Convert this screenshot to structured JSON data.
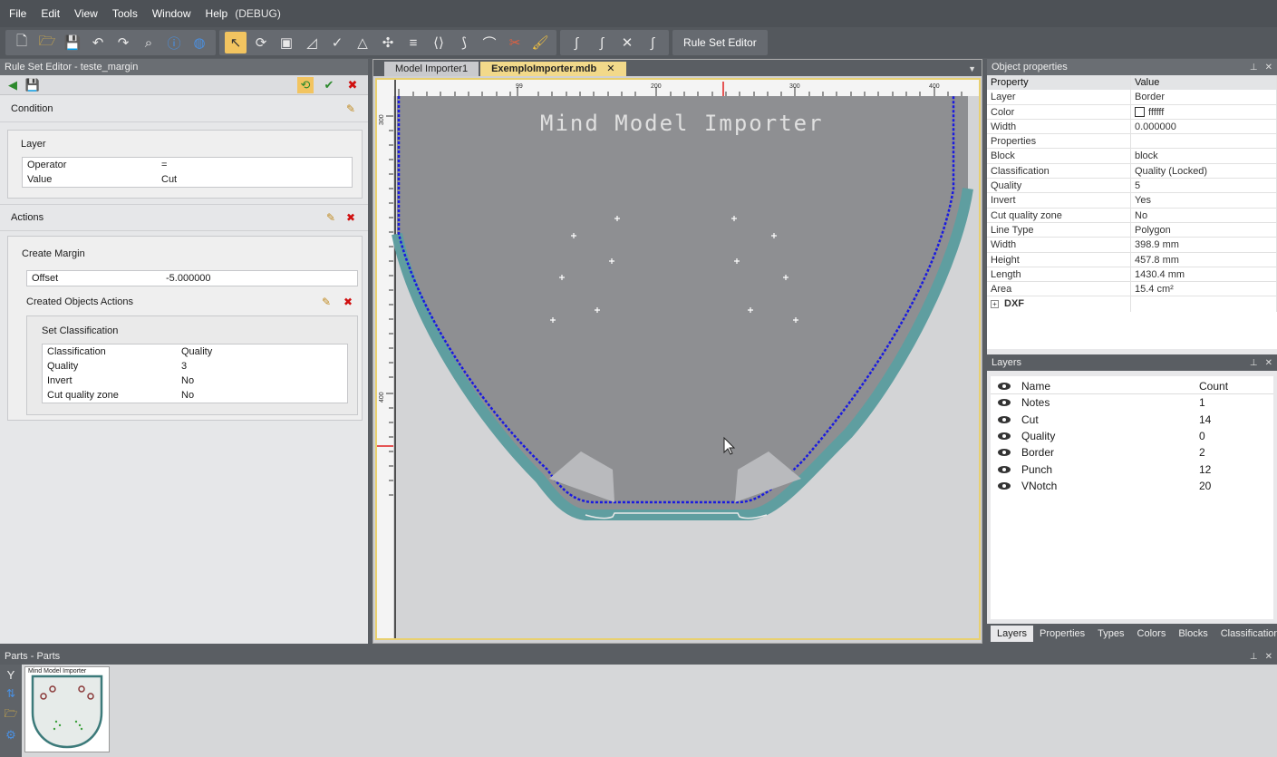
{
  "menu": [
    "File",
    "Edit",
    "View",
    "Tools",
    "Window",
    "Help",
    "(DEBUG)"
  ],
  "toolbar": {
    "rule_set_editor_label": "Rule Set Editor",
    "icons": [
      "new-file-icon",
      "open-folder-icon",
      "save-icon",
      "undo-icon",
      "redo-icon",
      "zoom-icon",
      "help-icon",
      "web-icon",
      "select-pointer-icon"
    ]
  },
  "left_panel": {
    "title": "Rule Set Editor - teste_margin",
    "condition": {
      "header": "Condition",
      "box_title": "Layer",
      "rows": [
        {
          "k": "Operator",
          "v": "="
        },
        {
          "k": "Value",
          "v": "Cut"
        }
      ]
    },
    "actions": {
      "header": "Actions",
      "create_margin": "Create Margin",
      "offset_label": "Offset",
      "offset_value": "-5.000000",
      "created_objects": "Created Objects Actions",
      "set_classification": "Set Classification",
      "rows": [
        {
          "k": "Classification",
          "v": "Quality"
        },
        {
          "k": "Quality",
          "v": "3"
        },
        {
          "k": "Invert",
          "v": "No"
        },
        {
          "k": "Cut quality zone",
          "v": "No"
        }
      ]
    }
  },
  "center": {
    "tabs": [
      "Model Importer1",
      "ExemploImporter.mdb"
    ],
    "canvas_text": "Mind Model Importer",
    "ruler_top": [
      "99",
      "200",
      "300",
      "400"
    ],
    "ruler_left": [
      "300",
      "400"
    ]
  },
  "object_properties": {
    "title": "Object properties",
    "col_property": "Property",
    "col_value": "Value",
    "rows": [
      {
        "k": "Layer",
        "v": "Border"
      },
      {
        "k": "Color",
        "v": "ffffff"
      },
      {
        "k": "Width",
        "v": "0.000000"
      },
      {
        "k": "Properties",
        "v": ""
      },
      {
        "k": "Block",
        "v": "block"
      },
      {
        "k": "Classification",
        "v": "Quality (Locked)"
      },
      {
        "k": "Quality",
        "v": "5"
      },
      {
        "k": "Invert",
        "v": "Yes"
      },
      {
        "k": "Cut quality zone",
        "v": "No"
      },
      {
        "k": "Line Type",
        "v": "Polygon"
      },
      {
        "k": "Width",
        "v": "398.9 mm"
      },
      {
        "k": "Height",
        "v": "457.8 mm"
      },
      {
        "k": "Length",
        "v": "1430.4 mm"
      },
      {
        "k": "Area",
        "v": "15.4 cm²"
      }
    ],
    "dxf_label": "DXF"
  },
  "layers": {
    "title": "Layers",
    "col_name": "Name",
    "col_count": "Count",
    "rows": [
      {
        "name": "Notes",
        "count": "1"
      },
      {
        "name": "Cut",
        "count": "14"
      },
      {
        "name": "Quality",
        "count": "0"
      },
      {
        "name": "Border",
        "count": "2"
      },
      {
        "name": "Punch",
        "count": "12"
      },
      {
        "name": "VNotch",
        "count": "20"
      }
    ],
    "tabs": [
      "Layers",
      "Properties",
      "Types",
      "Colors",
      "Blocks",
      "Classification"
    ]
  },
  "parts": {
    "title": "Parts - Parts",
    "thumb_label": "Mind Model Importer"
  },
  "colors": {
    "accent": "#f2c460",
    "teal": "#5f9ea0",
    "blue": "#1a1ae0"
  }
}
